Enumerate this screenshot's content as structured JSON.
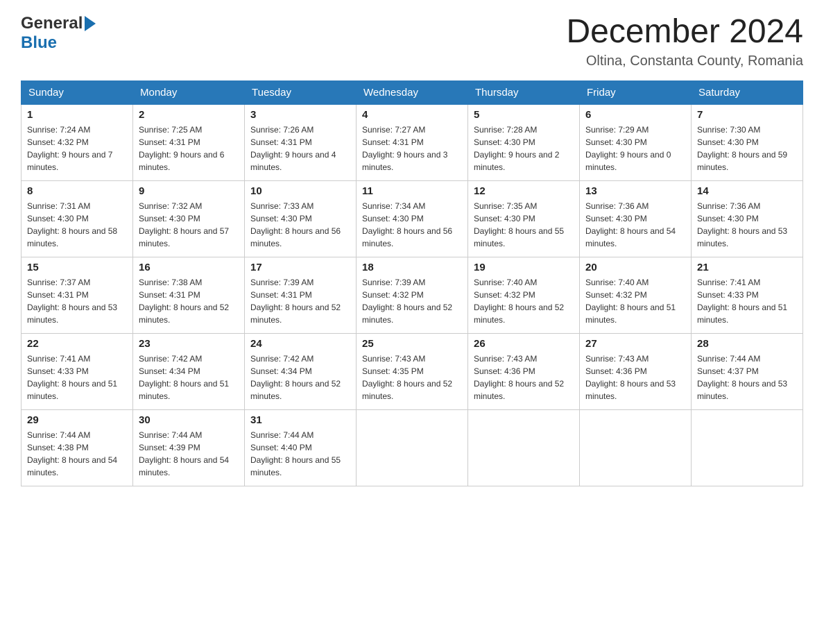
{
  "header": {
    "logo_general": "General",
    "logo_blue": "Blue",
    "title": "December 2024",
    "subtitle": "Oltina, Constanta County, Romania"
  },
  "days": [
    "Sunday",
    "Monday",
    "Tuesday",
    "Wednesday",
    "Thursday",
    "Friday",
    "Saturday"
  ],
  "weeks": [
    [
      {
        "day": "1",
        "sunrise": "7:24 AM",
        "sunset": "4:32 PM",
        "daylight": "9 hours and 7 minutes."
      },
      {
        "day": "2",
        "sunrise": "7:25 AM",
        "sunset": "4:31 PM",
        "daylight": "9 hours and 6 minutes."
      },
      {
        "day": "3",
        "sunrise": "7:26 AM",
        "sunset": "4:31 PM",
        "daylight": "9 hours and 4 minutes."
      },
      {
        "day": "4",
        "sunrise": "7:27 AM",
        "sunset": "4:31 PM",
        "daylight": "9 hours and 3 minutes."
      },
      {
        "day": "5",
        "sunrise": "7:28 AM",
        "sunset": "4:30 PM",
        "daylight": "9 hours and 2 minutes."
      },
      {
        "day": "6",
        "sunrise": "7:29 AM",
        "sunset": "4:30 PM",
        "daylight": "9 hours and 0 minutes."
      },
      {
        "day": "7",
        "sunrise": "7:30 AM",
        "sunset": "4:30 PM",
        "daylight": "8 hours and 59 minutes."
      }
    ],
    [
      {
        "day": "8",
        "sunrise": "7:31 AM",
        "sunset": "4:30 PM",
        "daylight": "8 hours and 58 minutes."
      },
      {
        "day": "9",
        "sunrise": "7:32 AM",
        "sunset": "4:30 PM",
        "daylight": "8 hours and 57 minutes."
      },
      {
        "day": "10",
        "sunrise": "7:33 AM",
        "sunset": "4:30 PM",
        "daylight": "8 hours and 56 minutes."
      },
      {
        "day": "11",
        "sunrise": "7:34 AM",
        "sunset": "4:30 PM",
        "daylight": "8 hours and 56 minutes."
      },
      {
        "day": "12",
        "sunrise": "7:35 AM",
        "sunset": "4:30 PM",
        "daylight": "8 hours and 55 minutes."
      },
      {
        "day": "13",
        "sunrise": "7:36 AM",
        "sunset": "4:30 PM",
        "daylight": "8 hours and 54 minutes."
      },
      {
        "day": "14",
        "sunrise": "7:36 AM",
        "sunset": "4:30 PM",
        "daylight": "8 hours and 53 minutes."
      }
    ],
    [
      {
        "day": "15",
        "sunrise": "7:37 AM",
        "sunset": "4:31 PM",
        "daylight": "8 hours and 53 minutes."
      },
      {
        "day": "16",
        "sunrise": "7:38 AM",
        "sunset": "4:31 PM",
        "daylight": "8 hours and 52 minutes."
      },
      {
        "day": "17",
        "sunrise": "7:39 AM",
        "sunset": "4:31 PM",
        "daylight": "8 hours and 52 minutes."
      },
      {
        "day": "18",
        "sunrise": "7:39 AM",
        "sunset": "4:32 PM",
        "daylight": "8 hours and 52 minutes."
      },
      {
        "day": "19",
        "sunrise": "7:40 AM",
        "sunset": "4:32 PM",
        "daylight": "8 hours and 52 minutes."
      },
      {
        "day": "20",
        "sunrise": "7:40 AM",
        "sunset": "4:32 PM",
        "daylight": "8 hours and 51 minutes."
      },
      {
        "day": "21",
        "sunrise": "7:41 AM",
        "sunset": "4:33 PM",
        "daylight": "8 hours and 51 minutes."
      }
    ],
    [
      {
        "day": "22",
        "sunrise": "7:41 AM",
        "sunset": "4:33 PM",
        "daylight": "8 hours and 51 minutes."
      },
      {
        "day": "23",
        "sunrise": "7:42 AM",
        "sunset": "4:34 PM",
        "daylight": "8 hours and 51 minutes."
      },
      {
        "day": "24",
        "sunrise": "7:42 AM",
        "sunset": "4:34 PM",
        "daylight": "8 hours and 52 minutes."
      },
      {
        "day": "25",
        "sunrise": "7:43 AM",
        "sunset": "4:35 PM",
        "daylight": "8 hours and 52 minutes."
      },
      {
        "day": "26",
        "sunrise": "7:43 AM",
        "sunset": "4:36 PM",
        "daylight": "8 hours and 52 minutes."
      },
      {
        "day": "27",
        "sunrise": "7:43 AM",
        "sunset": "4:36 PM",
        "daylight": "8 hours and 53 minutes."
      },
      {
        "day": "28",
        "sunrise": "7:44 AM",
        "sunset": "4:37 PM",
        "daylight": "8 hours and 53 minutes."
      }
    ],
    [
      {
        "day": "29",
        "sunrise": "7:44 AM",
        "sunset": "4:38 PM",
        "daylight": "8 hours and 54 minutes."
      },
      {
        "day": "30",
        "sunrise": "7:44 AM",
        "sunset": "4:39 PM",
        "daylight": "8 hours and 54 minutes."
      },
      {
        "day": "31",
        "sunrise": "7:44 AM",
        "sunset": "4:40 PM",
        "daylight": "8 hours and 55 minutes."
      },
      null,
      null,
      null,
      null
    ]
  ],
  "labels": {
    "sunrise": "Sunrise:",
    "sunset": "Sunset:",
    "daylight": "Daylight:"
  }
}
